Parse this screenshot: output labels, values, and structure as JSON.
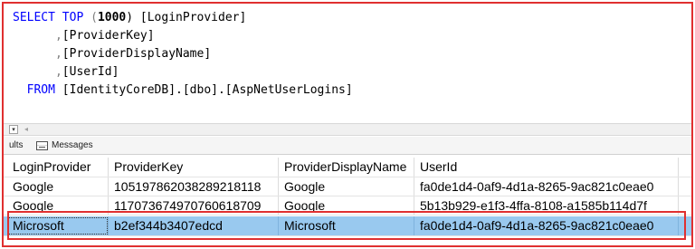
{
  "editor": {
    "lines": [
      {
        "kw": "SELECT TOP",
        "paren_open": " (",
        "num": "1000",
        "rest": ") [LoginProvider]"
      },
      {
        "prefix": "      ",
        "comma": ",",
        "rest": "[ProviderKey]"
      },
      {
        "prefix": "      ",
        "comma": ",",
        "rest": "[ProviderDisplayName]"
      },
      {
        "prefix": "      ",
        "comma": ",",
        "rest": "[UserId]"
      },
      {
        "prefix": "  ",
        "kw": "FROM",
        "rest": " [IdentityCoreDB].[dbo].[AspNetUserLogins]"
      }
    ]
  },
  "scrollbar": {
    "zoom_glyph": "▾",
    "left_arrow": "◂"
  },
  "tabs": {
    "results_label": "ults",
    "messages_label": "Messages"
  },
  "grid": {
    "columns": [
      "LoginProvider",
      "ProviderKey",
      "ProviderDisplayName",
      "UserId"
    ],
    "rows": [
      [
        "Google",
        "105197862038289218118",
        "Google",
        "fa0de1d4-0af9-4d1a-8265-9ac821c0eae0"
      ],
      [
        "Google",
        "117073674970760618709",
        "Google",
        "5b13b929-e1f3-4ffa-8108-a1585b114d7f"
      ],
      [
        "Microsoft",
        "b2ef344b3407edcd",
        "Microsoft",
        "fa0de1d4-0af9-4d1a-8265-9ac821c0eae0"
      ]
    ],
    "selected_row_index": 2
  },
  "colors": {
    "keyword": "#0000ff",
    "highlight_border": "#e03030",
    "selected_row": "#99c9ef"
  }
}
